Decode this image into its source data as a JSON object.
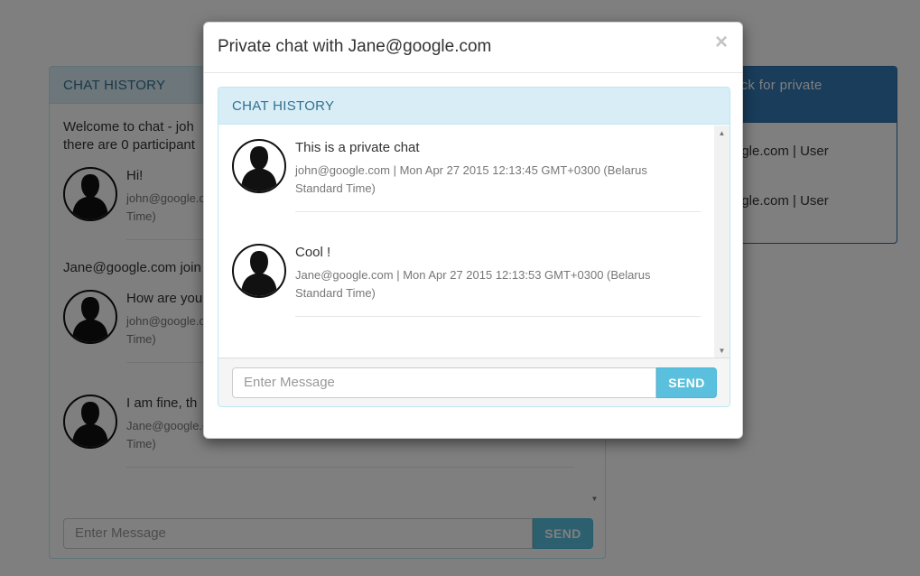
{
  "background": {
    "chat_panel": {
      "heading": "CHAT HISTORY",
      "system_line_1": "Welcome to chat - joh",
      "system_line_2": "there are 0 participant",
      "joined_line": "Jane@google.com join",
      "messages": [
        {
          "text": "Hi!",
          "meta_1": "john@google.c",
          "meta_2": "Time)"
        },
        {
          "text": "How are you",
          "meta_1": "john@google.c",
          "meta_2": "Time)"
        },
        {
          "text": "I am fine, th",
          "meta_1": "Jane@google.c",
          "meta_2": "Time)"
        }
      ],
      "input_placeholder": "Enter Message",
      "send_label": "SEND"
    },
    "users_panel": {
      "heading_line_1": ": (Click for private",
      "users": [
        "ogle.com | User",
        "ogle.com | User"
      ]
    }
  },
  "modal": {
    "title": "Private chat with Jane@google.com",
    "close_glyph": "×",
    "panel_heading": "CHAT HISTORY",
    "messages": [
      {
        "text": "This is a private chat",
        "meta": "john@google.com | Mon Apr 27 2015 12:13:45 GMT+0300 (Belarus Standard Time)"
      },
      {
        "text": "Cool !",
        "meta": "Jane@google.com | Mon Apr 27 2015 12:13:53 GMT+0300 (Belarus Standard Time)"
      }
    ],
    "input_placeholder": "Enter Message",
    "send_label": "SEND"
  },
  "icons": {
    "avatar": "user-silhouette-icon",
    "close": "close-icon",
    "scroll_up": "scroll-up-arrow-icon",
    "scroll_down": "scroll-down-arrow-icon"
  },
  "colors": {
    "info_heading_bg": "#d9edf7",
    "info_heading_text": "#31708f",
    "primary": "#337ab7",
    "send_button": "#5bc0de"
  }
}
